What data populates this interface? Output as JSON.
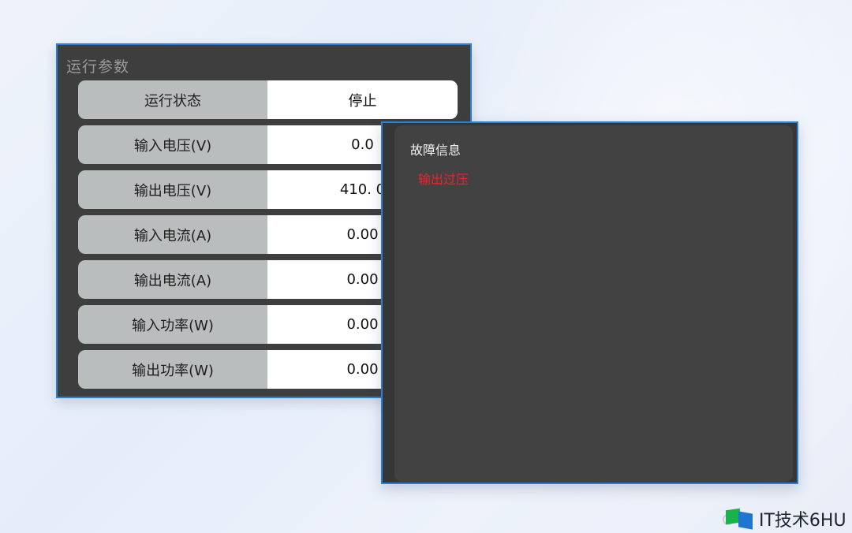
{
  "colors": {
    "accent_border": "#2a7fd8",
    "fault_text": "#e8262b"
  },
  "params_window": {
    "title": "运行参数",
    "rows": [
      {
        "label": "运行状态",
        "value": "停止"
      },
      {
        "label": "输入电压(V)",
        "value": "0.0"
      },
      {
        "label": "输出电压(V)",
        "value": "410. 0"
      },
      {
        "label": "输入电流(A)",
        "value": "0.00"
      },
      {
        "label": "输出电流(A)",
        "value": "0.00"
      },
      {
        "label": "输入功率(W)",
        "value": "0.00"
      },
      {
        "label": "输出功率(W)",
        "value": "0.00"
      }
    ]
  },
  "fault_window": {
    "title": "故障信息",
    "items": [
      "输出过压"
    ]
  },
  "watermark": {
    "logo_icon": "it-logo-icon",
    "text": "IT技术6HU"
  }
}
